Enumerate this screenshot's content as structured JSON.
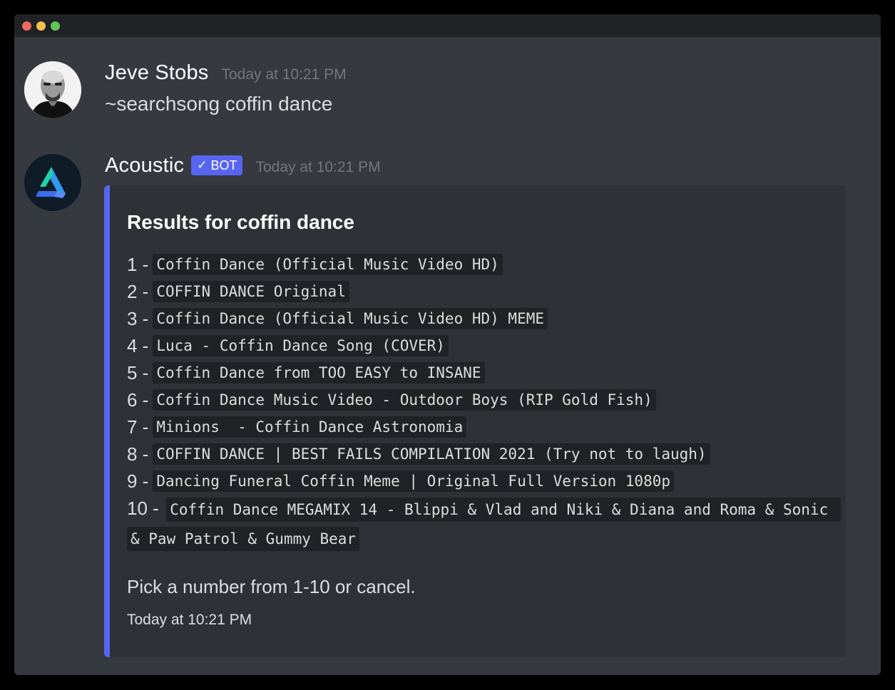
{
  "window": {
    "controls": [
      "close",
      "minimize",
      "maximize"
    ]
  },
  "messages": [
    {
      "author": "Jeve Stobs",
      "timestamp": "Today at 10:21 PM",
      "content": "~searchsong coffin dance",
      "avatar": "user-portrait"
    },
    {
      "author": "Acoustic",
      "badge": "BOT",
      "badge_icon": "checkmark-icon",
      "timestamp": "Today at 10:21 PM",
      "avatar": "acoustic-logo"
    }
  ],
  "embed": {
    "accent_color": "#5865f2",
    "title": "Results for coffin dance",
    "results": [
      {
        "num": "1 -",
        "title": "Coffin Dance (Official Music Video HD)"
      },
      {
        "num": "2 -",
        "title": "COFFIN DANCE Original"
      },
      {
        "num": "3 -",
        "title": "Coffin Dance (Official Music Video HD) MEME"
      },
      {
        "num": "4 -",
        "title": "Luca - Coffin Dance Song (COVER)"
      },
      {
        "num": "5 -",
        "title": "Coffin Dance from TOO EASY to INSANE"
      },
      {
        "num": "6 -",
        "title": "Coffin Dance Music Video - Outdoor Boys (RIP Gold Fish)"
      },
      {
        "num": "7 -",
        "title": "Minions  - Coffin Dance Astronomia"
      },
      {
        "num": "8 -",
        "title": "COFFIN DANCE | BEST FAILS COMPILATION 2021 (Try not to laugh)"
      },
      {
        "num": "9 -",
        "title": "Dancing Funeral Coffin Meme | Original Full Version 1080p"
      },
      {
        "num": "10 -",
        "title": "Coffin Dance MEGAMIX 14 - Blippi & Vlad and Niki & Diana and Roma & Sonic & Paw Patrol & Gummy Bear"
      }
    ],
    "description": "Pick a number from 1-10 or cancel.",
    "footer": "Today at 10:21 PM"
  }
}
